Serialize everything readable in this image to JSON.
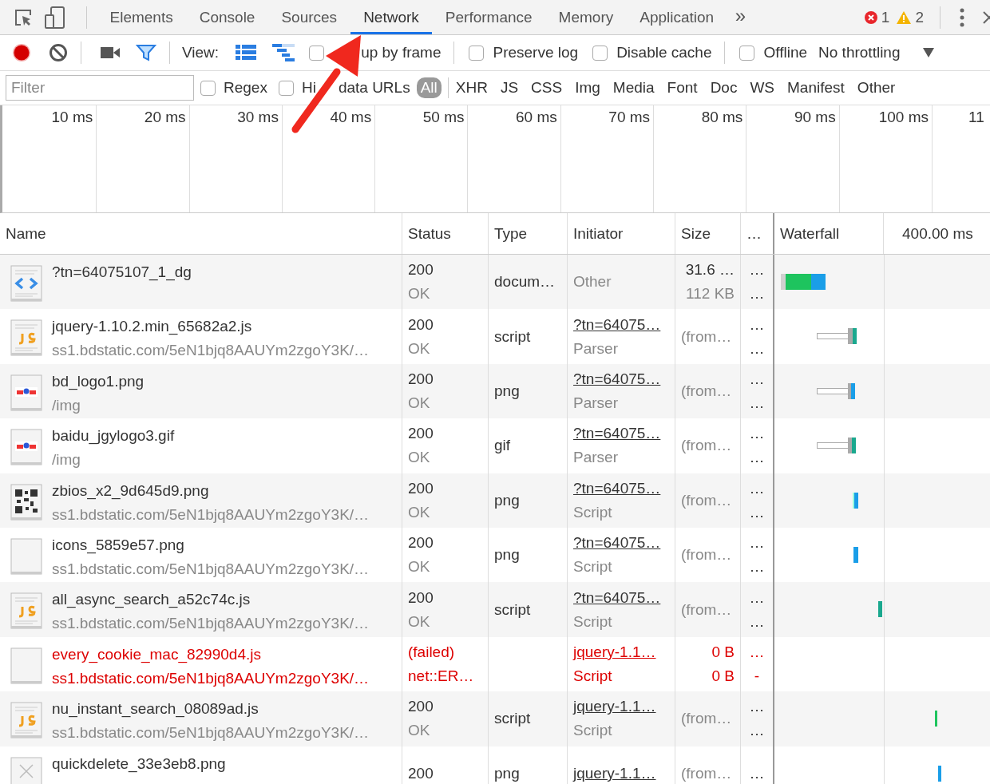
{
  "tabs": [
    {
      "label": "Elements",
      "selected": false
    },
    {
      "label": "Console",
      "selected": false
    },
    {
      "label": "Sources",
      "selected": false
    },
    {
      "label": "Network",
      "selected": true
    },
    {
      "label": "Performance",
      "selected": false
    },
    {
      "label": "Memory",
      "selected": false
    },
    {
      "label": "Application",
      "selected": false
    }
  ],
  "more_tabs": "»",
  "errors": "1",
  "warnings": "2",
  "toolbar": {
    "view_label": "View:",
    "options": [
      {
        "label_parts": [
          "up by frame"
        ],
        "checked": false
      },
      {
        "label_parts": [
          "Preserve log"
        ],
        "checked": false
      },
      {
        "label_parts": [
          "Disable cache"
        ],
        "checked": false
      },
      {
        "label_parts": [
          "Offline"
        ],
        "checked": false
      }
    ],
    "throttling": "No throttling"
  },
  "filter": {
    "placeholder": "Filter",
    "options": [
      {
        "label_parts": [
          "Regex"
        ],
        "checked": false
      },
      {
        "label_parts": [
          "Hi",
          "data URLs"
        ],
        "checked": false
      }
    ],
    "types": [
      {
        "label": "All",
        "selected": true
      },
      {
        "label": "XHR",
        "selected": false
      },
      {
        "label": "JS",
        "selected": false
      },
      {
        "label": "CSS",
        "selected": false
      },
      {
        "label": "Img",
        "selected": false
      },
      {
        "label": "Media",
        "selected": false
      },
      {
        "label": "Font",
        "selected": false
      },
      {
        "label": "Doc",
        "selected": false
      },
      {
        "label": "WS",
        "selected": false
      },
      {
        "label": "Manifest",
        "selected": false
      },
      {
        "label": "Other",
        "selected": false
      }
    ]
  },
  "overview_ticks": [
    "10 ms",
    "20 ms",
    "30 ms",
    "40 ms",
    "50 ms",
    "60 ms",
    "70 ms",
    "80 ms",
    "90 ms",
    "100 ms",
    "11"
  ],
  "columns": [
    "Name",
    "Status",
    "Type",
    "Initiator",
    "Size",
    "…",
    "Waterfall",
    "400.00 ms"
  ],
  "rows": [
    {
      "kind": "document",
      "name": "?tn=64075107_1_dg",
      "status": [
        "200",
        "OK"
      ],
      "type": "docum…",
      "initiator": [
        "Other"
      ],
      "linked": false,
      "size": [
        "31.6 …",
        "112 KB"
      ],
      "time": [
        "…",
        "…"
      ],
      "failed": false
    },
    {
      "kind": "script",
      "name": "jquery-1.10.2.min_65682a2.js",
      "path": "ss1.bdstatic.com/5eN1bjq8AAUYm2zgoY3K/…",
      "status": [
        "200",
        "OK"
      ],
      "type": "script",
      "initiator": [
        "?tn=64075…",
        "Parser"
      ],
      "linked": true,
      "size": [
        "(from…"
      ],
      "time": [
        "…",
        "…"
      ],
      "failed": false
    },
    {
      "kind": "image",
      "name": "bd_logo1.png",
      "path": "/img",
      "status": [
        "200",
        "OK"
      ],
      "type": "png",
      "initiator": [
        "?tn=64075…",
        "Parser"
      ],
      "linked": true,
      "size": [
        "(from…"
      ],
      "time": [
        "…",
        "…"
      ],
      "failed": false
    },
    {
      "kind": "image",
      "name": "baidu_jgylogo3.gif",
      "path": "/img",
      "status": [
        "200",
        "OK"
      ],
      "type": "gif",
      "initiator": [
        "?tn=64075…",
        "Parser"
      ],
      "linked": true,
      "size": [
        "(from…"
      ],
      "time": [
        "…",
        "…"
      ],
      "failed": false
    },
    {
      "kind": "qr",
      "name": "zbios_x2_9d645d9.png",
      "path": "ss1.bdstatic.com/5eN1bjq8AAUYm2zgoY3K/…",
      "status": [
        "200",
        "OK"
      ],
      "type": "png",
      "initiator": [
        "?tn=64075…",
        "Script"
      ],
      "linked": true,
      "size": [
        "(from…"
      ],
      "time": [
        "…",
        "…"
      ],
      "failed": false
    },
    {
      "kind": "blank",
      "name": "icons_5859e57.png",
      "path": "ss1.bdstatic.com/5eN1bjq8AAUYm2zgoY3K/…",
      "status": [
        "200",
        "OK"
      ],
      "type": "png",
      "initiator": [
        "?tn=64075…",
        "Script"
      ],
      "linked": true,
      "size": [
        "(from…"
      ],
      "time": [
        "…",
        "…"
      ],
      "failed": false
    },
    {
      "kind": "script",
      "name": "all_async_search_a52c74c.js",
      "path": "ss1.bdstatic.com/5eN1bjq8AAUYm2zgoY3K/…",
      "status": [
        "200",
        "OK"
      ],
      "type": "script",
      "initiator": [
        "?tn=64075…",
        "Script"
      ],
      "linked": true,
      "size": [
        "(from…"
      ],
      "time": [
        "…",
        "…"
      ],
      "failed": false
    },
    {
      "kind": "blank",
      "name": "every_cookie_mac_82990d4.js",
      "path": "ss1.bdstatic.com/5eN1bjq8AAUYm2zgoY3K/…",
      "status": [
        "(failed)",
        "net::ER…"
      ],
      "initiator": [
        "jquery-1.1…",
        "Script"
      ],
      "linked": true,
      "size": [
        "0 B",
        "0 B"
      ],
      "time": [
        "…",
        "-"
      ],
      "failed": true
    },
    {
      "kind": "script",
      "name": "nu_instant_search_08089ad.js",
      "path": "ss1.bdstatic.com/5eN1bjq8AAUYm2zgoY3K/…",
      "status": [
        "200",
        "OK"
      ],
      "type": "script",
      "initiator": [
        "jquery-1.1…",
        "Script"
      ],
      "linked": true,
      "size": [
        "(from…"
      ],
      "time": [
        "…",
        "…"
      ],
      "failed": false
    },
    {
      "kind": "broken",
      "name": "quickdelete_33e3eb8.png",
      "status": [
        "200"
      ],
      "type": "png",
      "initiator": [
        "jquery-1.1…"
      ],
      "linked": true,
      "size": [
        "(from…"
      ],
      "time": [
        "…"
      ],
      "failed": false
    }
  ]
}
